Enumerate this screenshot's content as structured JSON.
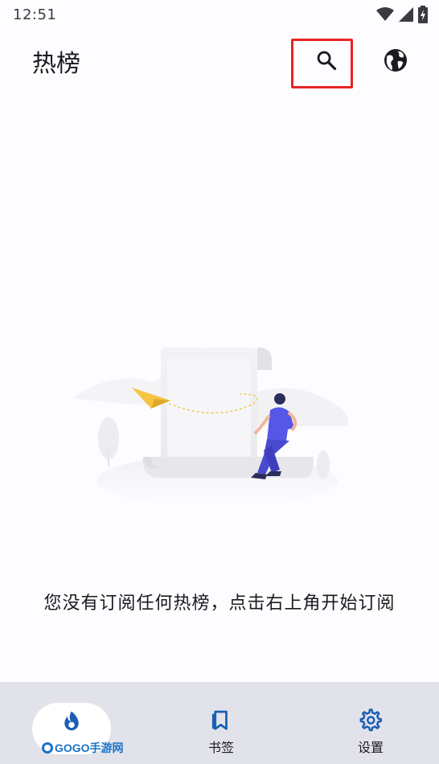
{
  "status_bar": {
    "time": "12:51",
    "icons": [
      "wifi-icon",
      "signal-icon",
      "battery-icon"
    ]
  },
  "app_bar": {
    "title": "热榜",
    "actions": [
      "search-icon",
      "globe-icon"
    ]
  },
  "empty_state": {
    "illustration": "empty-subscription-illustration",
    "message": "您没有订阅任何热榜，点击右上角开始订阅"
  },
  "bottom_nav": {
    "items": [
      {
        "id": "home",
        "label": "",
        "icon": "flame-icon",
        "selected": true
      },
      {
        "id": "bookmarks",
        "label": "书签",
        "icon": "bookmark-icon",
        "selected": false
      },
      {
        "id": "settings",
        "label": "设置",
        "icon": "gear-icon",
        "selected": false
      }
    ]
  },
  "watermark": {
    "text": "GOGO手游网"
  },
  "colors": {
    "accent": "#1a5fb4",
    "highlight_box": "#e82424",
    "nav_background": "#e2e3ea",
    "page_background": "#fdfcff"
  }
}
